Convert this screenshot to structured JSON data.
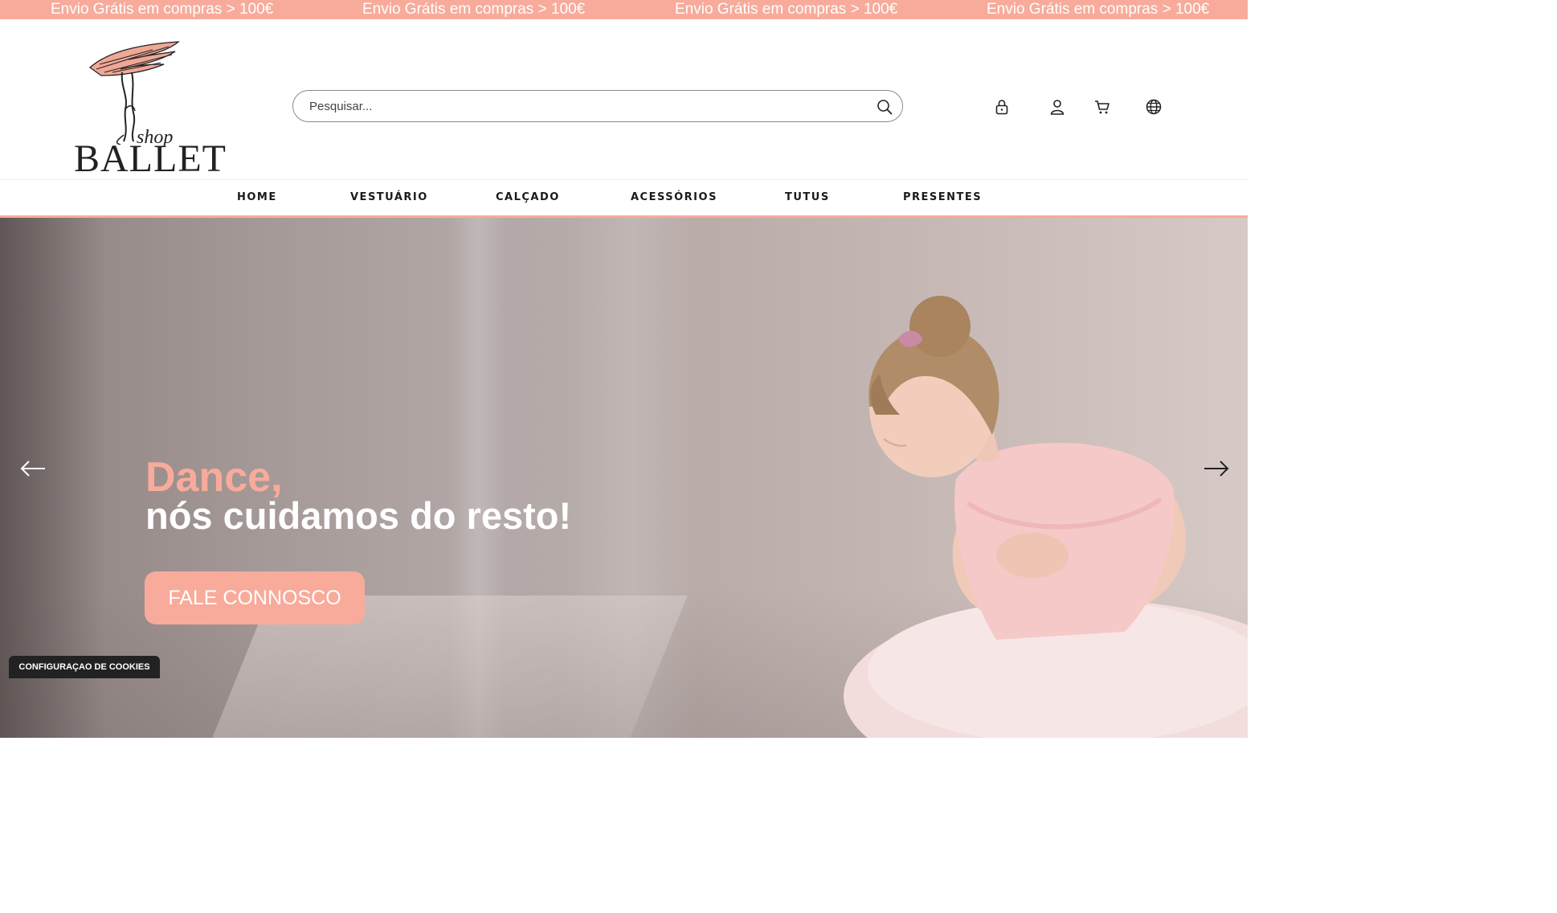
{
  "promo_bar": {
    "items": [
      "Envio Grátis em compras > 100€",
      "Envio Grátis em compras > 100€",
      "Envio Grátis em compras > 100€",
      "Envio Grátis em compras > 100€"
    ]
  },
  "header": {
    "logo": {
      "script": "shop",
      "wordmark": "BALLET"
    },
    "search": {
      "placeholder": "Pesquisar...",
      "value": ""
    },
    "icons": [
      "lock-icon",
      "user-icon",
      "cart-icon",
      "globe-icon"
    ]
  },
  "nav": {
    "items": [
      "HOME",
      "VESTUÁRIO",
      "CALÇADO",
      "ACESSÓRIOS",
      "TUTUS",
      "PRESENTES"
    ]
  },
  "hero": {
    "title_accent": "Dance,",
    "title_rest": "nós cuidamos do resto!",
    "cta_label": "FALE CONNOSCO",
    "prev_icon": "arrow-left-icon",
    "next_icon": "arrow-right-icon"
  },
  "cookie_banner": {
    "label": "CONFIGURAÇAO DE COOKIES"
  },
  "colors": {
    "accent": "#f8ab9b",
    "text_dark": "#1a1a1a",
    "cookie_bg": "#222222"
  }
}
